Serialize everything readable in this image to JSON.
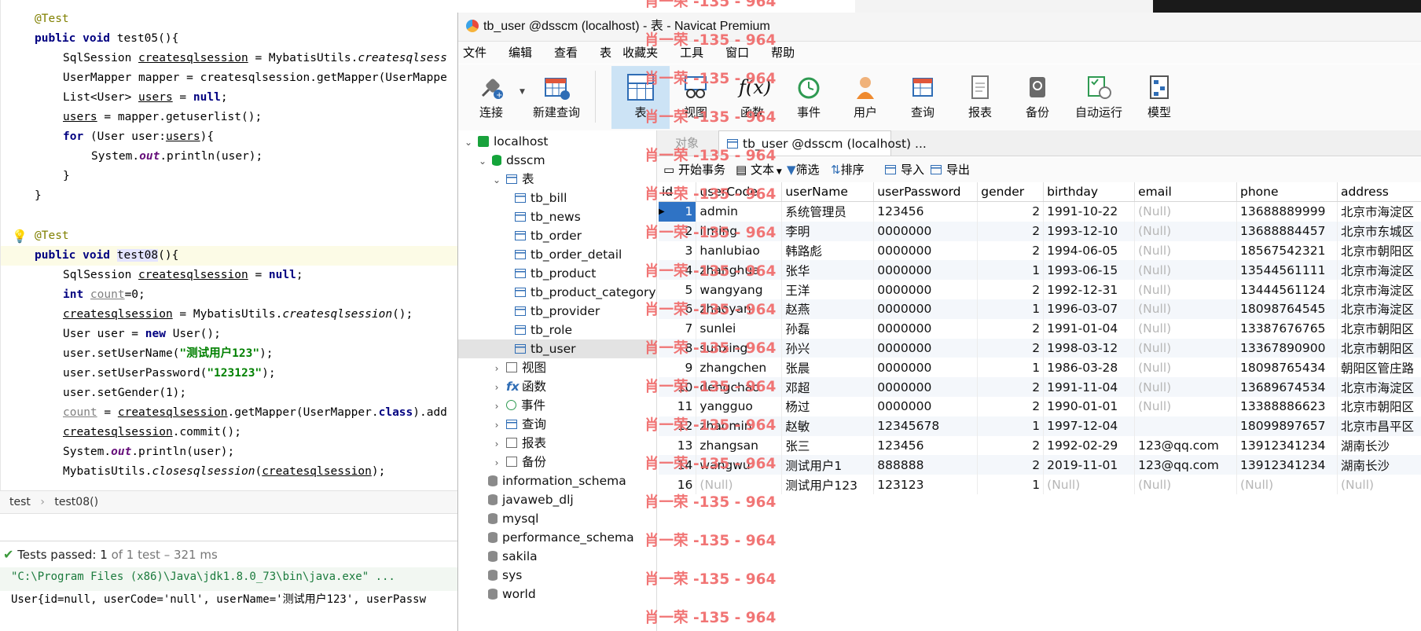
{
  "ide": {
    "breadcrumb": [
      "test",
      "test08()"
    ],
    "run_status": {
      "label": "Tests passed:",
      "passed": "1",
      "rest": "of 1 test – 321 ms"
    },
    "console_cmd": "\"C:\\Program Files (x86)\\Java\\jdk1.8.0_73\\bin\\java.exe\" ...",
    "console_out": "User{id=null, userCode='null', userName='测试用户123', userPassw"
  },
  "navicat": {
    "window_title": "tb_user @dsscm (localhost) - 表 - Navicat Premium",
    "menu": [
      "文件",
      "编辑",
      "查看",
      "表",
      "收藏夹",
      "工具",
      "窗口",
      "帮助"
    ],
    "toolbar": [
      {
        "label": "连接",
        "icon": "connect-icon"
      },
      {
        "label": "新建查询",
        "icon": "new-query-icon"
      },
      {
        "label": "表",
        "icon": "table-icon",
        "active": true
      },
      {
        "label": "视图",
        "icon": "view-icon"
      },
      {
        "label": "函数",
        "icon": "function-icon"
      },
      {
        "label": "事件",
        "icon": "event-icon"
      },
      {
        "label": "用户",
        "icon": "user-icon"
      },
      {
        "label": "查询",
        "icon": "query-icon"
      },
      {
        "label": "报表",
        "icon": "report-icon"
      },
      {
        "label": "备份",
        "icon": "backup-icon"
      },
      {
        "label": "自动运行",
        "icon": "autorun-icon"
      },
      {
        "label": "模型",
        "icon": "model-icon"
      }
    ],
    "tree": {
      "connection": "localhost",
      "database": "dsscm",
      "tables_folder": "表",
      "tables": [
        "tb_bill",
        "tb_news",
        "tb_order",
        "tb_order_detail",
        "tb_product",
        "tb_product_category",
        "tb_provider",
        "tb_role",
        "tb_user"
      ],
      "folders": [
        "视图",
        "函数",
        "事件",
        "查询",
        "报表",
        "备份"
      ],
      "other_dbs": [
        "information_schema",
        "javaweb_dlj",
        "mysql",
        "performance_schema",
        "sakila",
        "sys",
        "world"
      ]
    },
    "tabs": {
      "objects": "对象",
      "active": "tb_user @dsscm (localhost) ..."
    },
    "table_toolbar": {
      "begin_tx": "开始事务",
      "text": "文本",
      "filter": "筛选",
      "sort": "排序",
      "import": "导入",
      "export": "导出"
    },
    "grid": {
      "columns": [
        "id",
        "userCode",
        "userName",
        "userPassword",
        "gender",
        "birthday",
        "email",
        "phone",
        "address"
      ],
      "rows": [
        [
          "1",
          "admin",
          "系统管理员",
          "123456",
          "2",
          "1991-10-22",
          "(Null)",
          "13688889999",
          "北京市海淀区"
        ],
        [
          "2",
          "liming",
          "李明",
          "0000000",
          "2",
          "1993-12-10",
          "(Null)",
          "13688884457",
          "北京市东城区"
        ],
        [
          "3",
          "hanlubiao",
          "韩路彪",
          "0000000",
          "2",
          "1994-06-05",
          "(Null)",
          "18567542321",
          "北京市朝阳区"
        ],
        [
          "4",
          "zhanghua",
          "张华",
          "0000000",
          "1",
          "1993-06-15",
          "(Null)",
          "13544561111",
          "北京市海淀区"
        ],
        [
          "5",
          "wangyang",
          "王洋",
          "0000000",
          "2",
          "1992-12-31",
          "(Null)",
          "13444561124",
          "北京市海淀区"
        ],
        [
          "6",
          "zhaoyan",
          "赵燕",
          "0000000",
          "1",
          "1996-03-07",
          "(Null)",
          "18098764545",
          "北京市海淀区"
        ],
        [
          "7",
          "sunlei",
          "孙磊",
          "0000000",
          "2",
          "1991-01-04",
          "(Null)",
          "13387676765",
          "北京市朝阳区"
        ],
        [
          "8",
          "sunxing",
          "孙兴",
          "0000000",
          "2",
          "1998-03-12",
          "(Null)",
          "13367890900",
          "北京市朝阳区"
        ],
        [
          "9",
          "zhangchen",
          "张晨",
          "0000000",
          "1",
          "1986-03-28",
          "(Null)",
          "18098765434",
          "朝阳区管庄路"
        ],
        [
          "10",
          "dengchao",
          "邓超",
          "0000000",
          "2",
          "1991-11-04",
          "(Null)",
          "13689674534",
          "北京市海淀区"
        ],
        [
          "11",
          "yangguo",
          "杨过",
          "0000000",
          "2",
          "1990-01-01",
          "(Null)",
          "13388886623",
          "北京市朝阳区"
        ],
        [
          "12",
          "zhaomin",
          "赵敏",
          "12345678",
          "1",
          "1997-12-04",
          "",
          "18099897657",
          "北京市昌平区"
        ],
        [
          "13",
          "zhangsan",
          "张三",
          "123456",
          "2",
          "1992-02-29",
          "123@qq.com",
          "13912341234",
          "湖南长沙"
        ],
        [
          "14",
          "wangwu",
          "测试用户1",
          "888888",
          "2",
          "2019-11-01",
          "123@qq.com",
          "13912341234",
          "湖南长沙"
        ],
        [
          "16",
          "(Null)",
          "测试用户123",
          "123123",
          "1",
          "(Null)",
          "(Null)",
          "(Null)",
          "(Null)"
        ]
      ]
    }
  },
  "watermark": "肖一荣 -135 - 964"
}
